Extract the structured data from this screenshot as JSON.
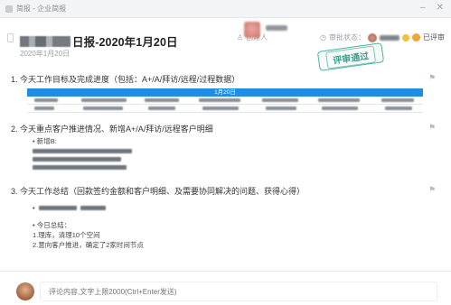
{
  "window": {
    "breadcrumb": "简报 - 企业简报",
    "minimize_icon": "minimize-icon",
    "close_icon": "close-icon"
  },
  "report": {
    "title_suffix": "日报-2020年1月20日",
    "date": "2020年1月20日",
    "creator_label": "创建人",
    "review_label": "审批状态：",
    "review_done": "已评审",
    "stamp": "评审通过"
  },
  "sections": [
    {
      "heading": "1. 今天工作目标及完成进度（包括：A+/A/拜访/远程/过程数据）"
    },
    {
      "heading": "2. 今天重点客户推进情况、新增A+/A/拜访/远程客户明细",
      "sub_label": "新增B:"
    },
    {
      "heading": "3. 今天工作总结（回款签约金额和客户明细、及需要协同解决的问题、获得心得）",
      "summary_label": "今日总结：",
      "summary_lines": [
        "1.理库，清理10个空间",
        "2.意向客户推进，确定了2家时间节点"
      ]
    }
  ],
  "table": {
    "header": "1月20日"
  },
  "comment": {
    "placeholder": "评论内容,文字上限2000(Ctrl+Enter发送)"
  },
  "colors": {
    "accent": "#1f8ce6",
    "stamp": "#3aa08c"
  }
}
